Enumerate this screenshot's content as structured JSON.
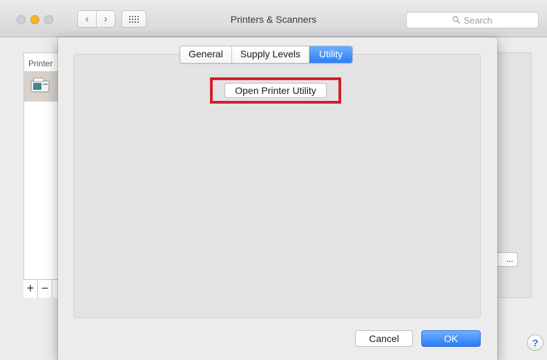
{
  "window": {
    "title": "Printers & Scanners"
  },
  "search": {
    "placeholder": "Search"
  },
  "background": {
    "list_header": "Printer",
    "add_label": "+",
    "remove_label": "−",
    "options_button_label": "..."
  },
  "sheet": {
    "tabs": [
      {
        "label": "General",
        "selected": false
      },
      {
        "label": "Supply Levels",
        "selected": false
      },
      {
        "label": "Utility",
        "selected": true
      }
    ],
    "open_utility_label": "Open Printer Utility",
    "cancel_label": "Cancel",
    "ok_label": "OK"
  },
  "help": {
    "label": "?"
  },
  "colors": {
    "accent": "#2e7ff5",
    "highlight_box": "#d3202a",
    "minimize_light": "#f7b627"
  }
}
